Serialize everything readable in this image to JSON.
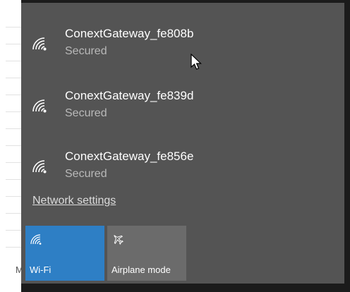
{
  "background": {
    "fragment_text": "M"
  },
  "networks": [
    {
      "ssid": "ConextGateway_fe808b",
      "status": "Secured",
      "icon": "wifi-signal-icon"
    },
    {
      "ssid": "ConextGateway_fe839d",
      "status": "Secured",
      "icon": "wifi-signal-icon"
    },
    {
      "ssid": "ConextGateway_fe856e",
      "status": "Secured",
      "icon": "wifi-signal-icon"
    }
  ],
  "network_settings_label": "Network settings",
  "quick_actions": [
    {
      "label": "Wi-Fi",
      "icon": "wifi-icon",
      "state": "on",
      "color": "#2e7fc5"
    },
    {
      "label": "Airplane mode",
      "icon": "airplane-icon",
      "state": "off",
      "color": "#6b6b6b"
    }
  ],
  "colors": {
    "panel": "#545454",
    "accent": "#2e7fc5",
    "text_primary": "#ffffff",
    "text_secondary": "#b9b9b9"
  }
}
